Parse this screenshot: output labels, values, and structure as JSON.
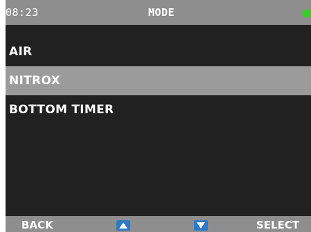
{
  "status": {
    "time": "08:23",
    "title": "MODE",
    "battery_color": "#3bcc2a"
  },
  "menu": {
    "items": [
      {
        "label": "AIR",
        "selected": false
      },
      {
        "label": "NITROX",
        "selected": true
      },
      {
        "label": "BOTTOM TIMER",
        "selected": false
      }
    ]
  },
  "softkeys": {
    "back": "BACK",
    "select": "SELECT",
    "up_icon": "arrow-up-icon",
    "down_icon": "arrow-down-icon",
    "accent": "#2d78c9"
  }
}
